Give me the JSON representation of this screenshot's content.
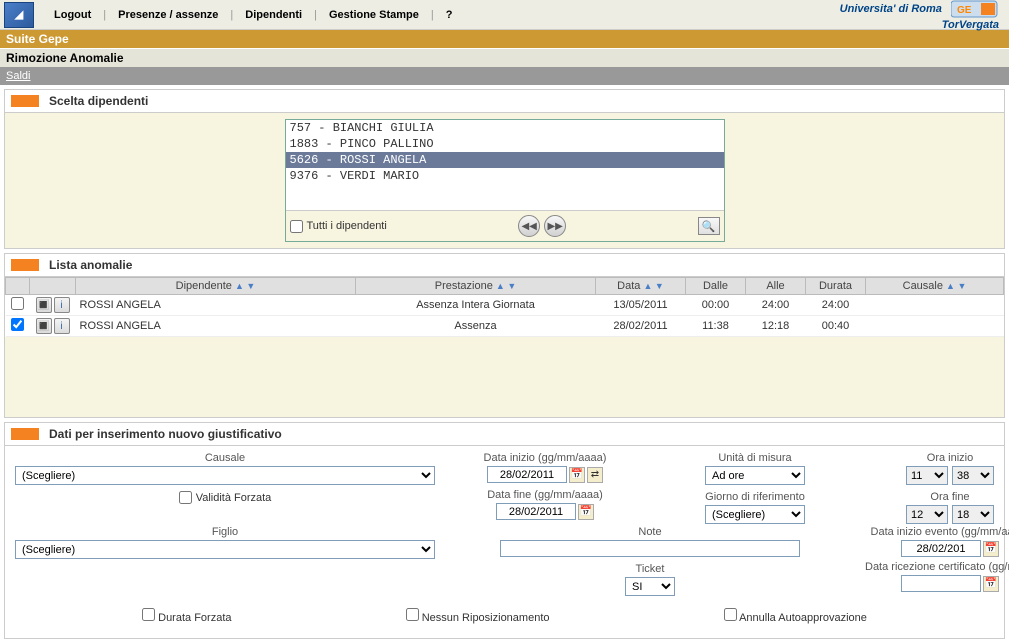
{
  "menu": {
    "logout": "Logout",
    "presenze": "Presenze / assenze",
    "dipendenti": "Dipendenti",
    "stampe": "Gestione Stampe",
    "help": "?"
  },
  "header": {
    "uni1": "Universita' di Roma",
    "uni2": "TorVergata",
    "suite": "Suite Gepe",
    "page": "Rimozione Anomalie",
    "saldi": "Saldi"
  },
  "section1": {
    "title": "Scelta dipendenti",
    "employees": [
      "757 - BIANCHI GIULIA",
      "1883 - PINCO PALLINO",
      "5626 - ROSSI ANGELA",
      "9376 - VERDI MARIO"
    ],
    "selected_index": 2,
    "tutti": "Tutti i dipendenti"
  },
  "section2": {
    "title": "Lista anomalie",
    "cols": {
      "dipendente": "Dipendente",
      "prestazione": "Prestazione",
      "data": "Data",
      "dalle": "Dalle",
      "alle": "Alle",
      "durata": "Durata",
      "causale": "Causale"
    },
    "rows": [
      {
        "checked": false,
        "dip": "ROSSI ANGELA",
        "prest": "Assenza Intera Giornata",
        "data": "13/05/2011",
        "dalle": "00:00",
        "alle": "24:00",
        "durata": "24:00",
        "caus": ""
      },
      {
        "checked": true,
        "dip": "ROSSI ANGELA",
        "prest": "Assenza",
        "data": "28/02/2011",
        "dalle": "11:38",
        "alle": "12:18",
        "durata": "00:40",
        "caus": ""
      }
    ]
  },
  "section3": {
    "title": "Dati per inserimento nuovo giustificativo",
    "labels": {
      "causale": "Causale",
      "validita": "Validità Forzata",
      "figlio": "Figlio",
      "data_inizio": "Data inizio (gg/mm/aaaa)",
      "data_fine": "Data fine (gg/mm/aaaa)",
      "unita": "Unità di misura",
      "giorno_rif": "Giorno di riferimento",
      "note": "Note",
      "ticket": "Ticket",
      "ora_inizio": "Ora inizio",
      "ora_fine": "Ora fine",
      "data_evento": "Data inizio evento (gg/mm/aaaa)",
      "data_cert": "Data ricezione certificato (gg/mm/aaaa)",
      "durata_forzata": "Durata Forzata",
      "nessun_rip": "Nessun Riposizionamento",
      "annulla_auto": "Annulla Autoapprovazione"
    },
    "values": {
      "scegliere": "(Scegliere)",
      "ad_ore": "Ad ore",
      "si": "SI",
      "date1": "28/02/2011",
      "date2": "28/02/2011",
      "date3": "28/02/201",
      "h1": "11",
      "m1": "38",
      "h2": "12",
      "m2": "18"
    }
  }
}
